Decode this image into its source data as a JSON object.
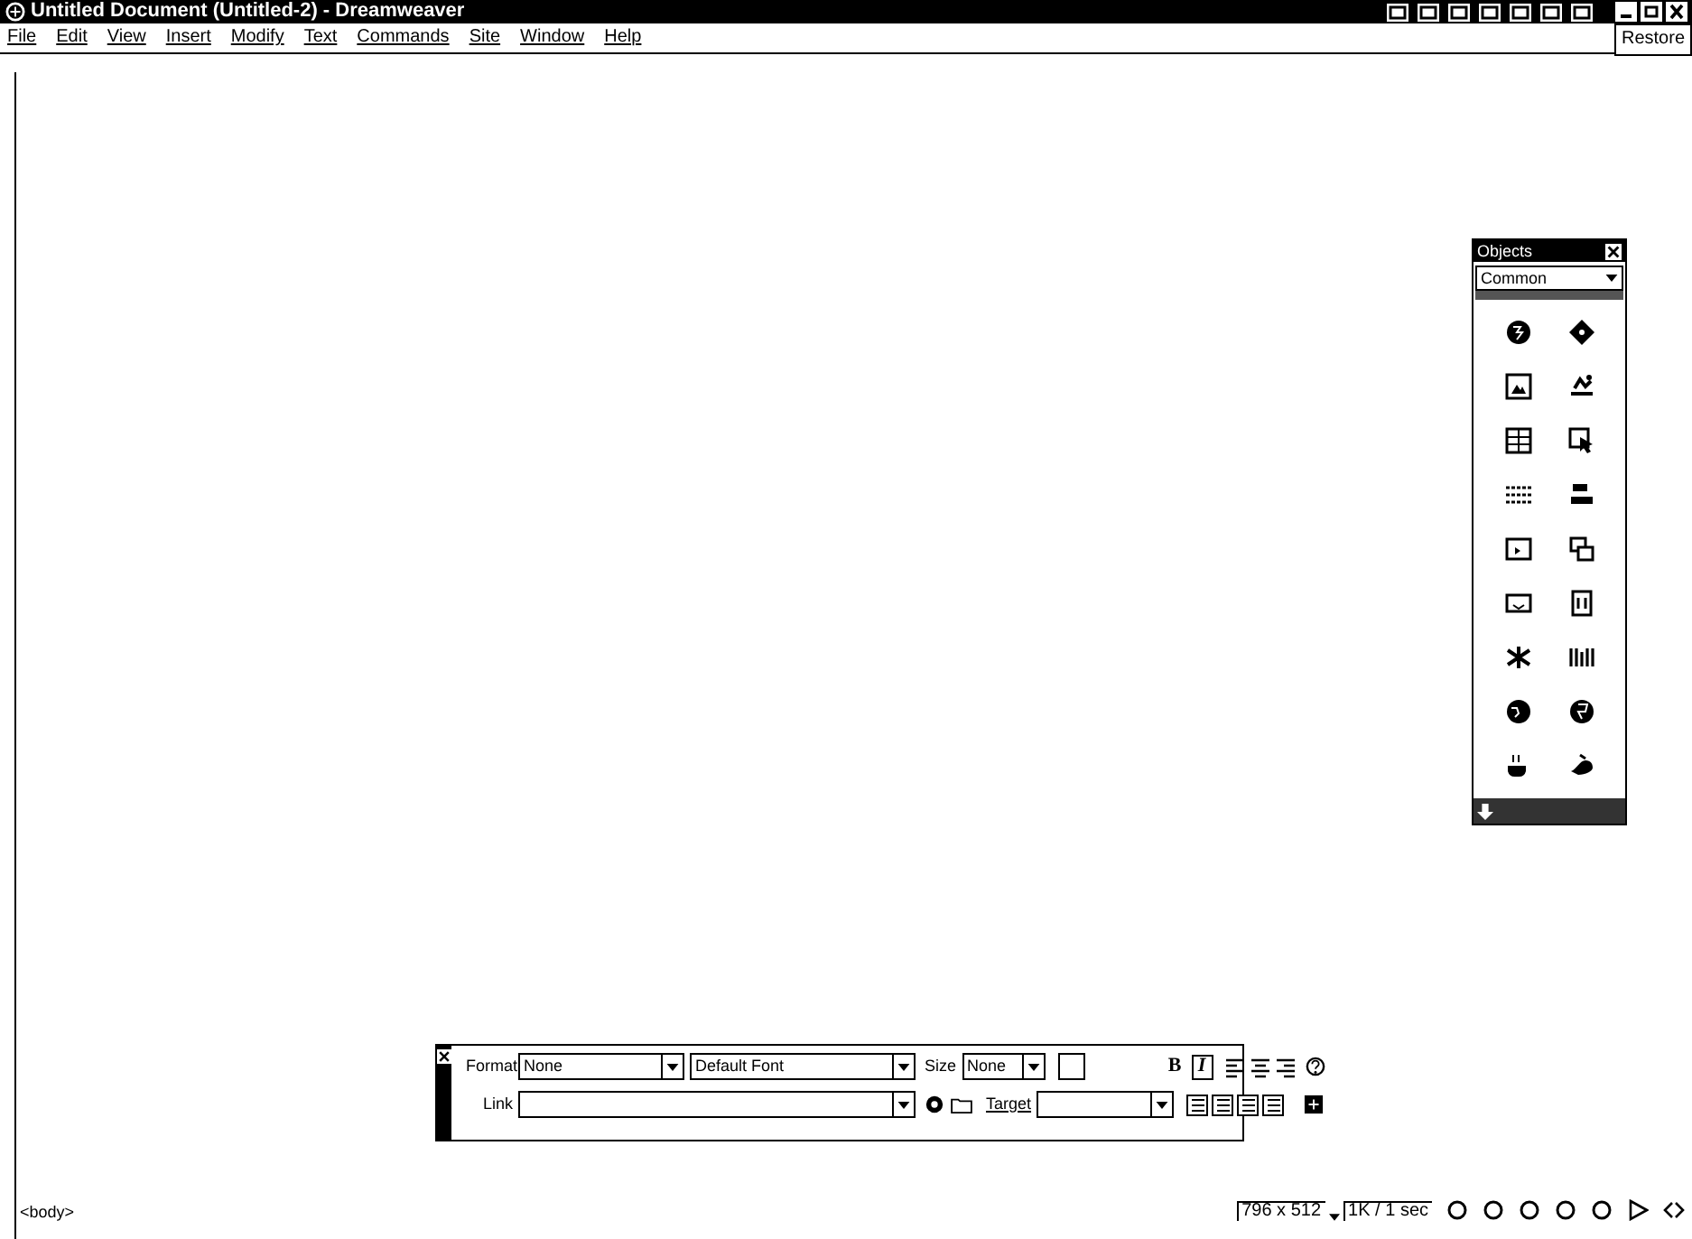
{
  "window": {
    "title": "Untitled Document (Untitled-2) - Dreamweaver",
    "tooltip": "Restore"
  },
  "menu": [
    {
      "label": "File"
    },
    {
      "label": "Edit"
    },
    {
      "label": "View"
    },
    {
      "label": "Insert"
    },
    {
      "label": "Modify"
    },
    {
      "label": "Text"
    },
    {
      "label": "Commands"
    },
    {
      "label": "Site"
    },
    {
      "label": "Window"
    },
    {
      "label": "Help"
    }
  ],
  "objects_panel": {
    "title": "Objects",
    "category": "Common"
  },
  "properties": {
    "format_label": "Format",
    "format_value": "None",
    "font_value": "Default Font",
    "size_label": "Size",
    "size_value": "None",
    "bold": "B",
    "italic": "I",
    "link_label": "Link",
    "target_label": "Target"
  },
  "status_bar": {
    "tag": "<body>",
    "window_size": "796 x 512",
    "download": "1K / 1 sec"
  }
}
